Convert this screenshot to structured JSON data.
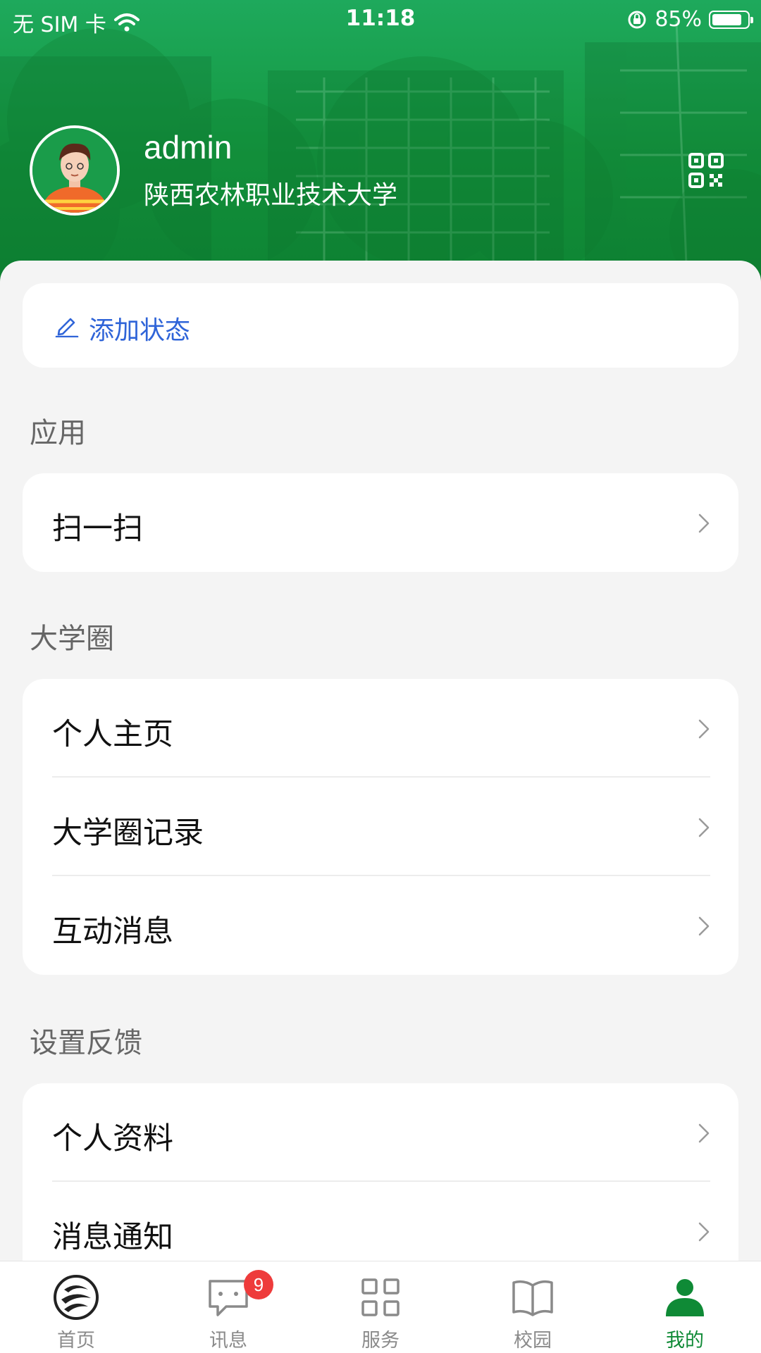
{
  "status_bar": {
    "carrier": "无 SIM 卡",
    "time": "11:18",
    "battery": "85%",
    "battery_level": 0.85
  },
  "profile": {
    "username": "admin",
    "school": "陕西农林职业技术大学"
  },
  "status_card": {
    "label": "添加状态"
  },
  "sections": [
    {
      "title": "应用",
      "items": [
        "扫一扫"
      ]
    },
    {
      "title": "大学圈",
      "items": [
        "个人主页",
        "大学圈记录",
        "互动消息"
      ]
    },
    {
      "title": "设置反馈",
      "items": [
        "个人资料",
        "消息通知"
      ]
    }
  ],
  "tabbar": {
    "tabs": [
      {
        "label": "首页",
        "icon": "home-logo-icon"
      },
      {
        "label": "讯息",
        "icon": "chat-icon",
        "badge": "9"
      },
      {
        "label": "服务",
        "icon": "grid-icon"
      },
      {
        "label": "校园",
        "icon": "book-icon"
      },
      {
        "label": "我的",
        "icon": "person-icon",
        "active": true
      }
    ]
  },
  "colors": {
    "brand_green": "#14973f",
    "link_blue": "#2f64d8",
    "badge_red": "#ee3b3b"
  }
}
